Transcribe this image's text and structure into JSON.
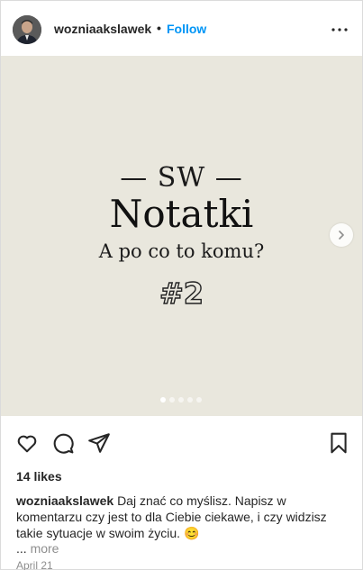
{
  "header": {
    "username": "wozniaakslawek",
    "separator": "•",
    "follow_label": "Follow",
    "more_icon": "more-horizontal-icon"
  },
  "slide": {
    "small_title": "— SW —",
    "title": "Notatki",
    "subtitle": "A po co to komu?",
    "number": "#2",
    "background": "#e9e7dd",
    "dots": 5,
    "active_dot": 1
  },
  "actions": {
    "like_icon": "heart-icon",
    "comment_icon": "comment-icon",
    "share_icon": "send-icon",
    "save_icon": "bookmark-icon"
  },
  "likes": "14 likes",
  "caption": {
    "username": "wozniaakslawek",
    "text": "Daj znać co myślisz. Napisz w komentarzu czy jest to dla Ciebie ciekawe, i czy widzisz takie sytuacje w swoim życiu. 😊",
    "ellipsis": "...",
    "more_label": "more"
  },
  "date": "April 21",
  "colors": {
    "accent": "#0095f6",
    "muted": "#8e8e8e",
    "text": "#262626"
  }
}
